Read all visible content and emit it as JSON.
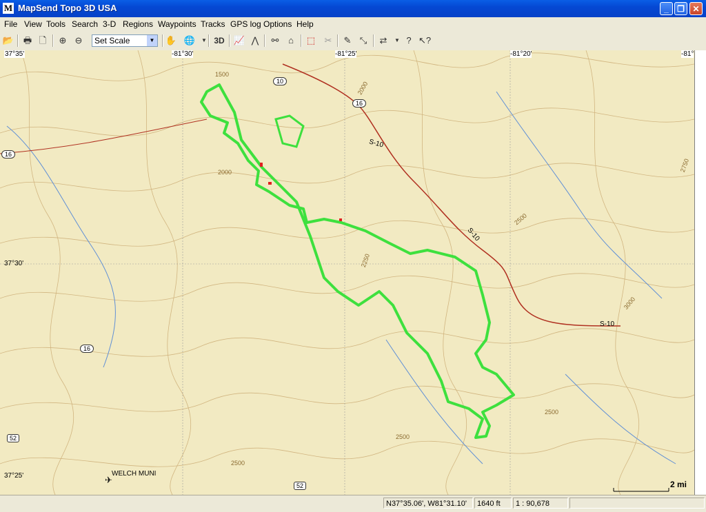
{
  "window": {
    "title": "MapSend Topo 3D USA",
    "icon_letter": "M"
  },
  "menu": [
    "File",
    "View",
    "Tools",
    "Search",
    "3-D",
    "Regions",
    "Waypoints",
    "Tracks",
    "GPS log",
    "Options",
    "Help"
  ],
  "toolbar": {
    "scale_value": "Set Scale",
    "btn_3d": "3D"
  },
  "map": {
    "lat_labels": [
      "37°35'",
      "37°30'",
      "37°25'"
    ],
    "lon_labels": [
      "-81°30'",
      "-81°25'",
      "-81°20'",
      "-81°"
    ],
    "roads": [
      "10",
      "16",
      "16",
      "16",
      "52",
      "52"
    ],
    "state_roads": [
      "S-10",
      "S-10",
      "S-10"
    ],
    "contours": [
      "1500",
      "2000",
      "2000",
      "2500",
      "2500",
      "2500",
      "3000",
      "2750",
      "2500",
      "2250"
    ],
    "place": "WELCH MUNI",
    "scale_bar": "2 mi"
  },
  "status": {
    "coords": "N37°35.06', W81°31.10'",
    "elevation": "1640 ft",
    "scale": "1 : 90,678"
  }
}
